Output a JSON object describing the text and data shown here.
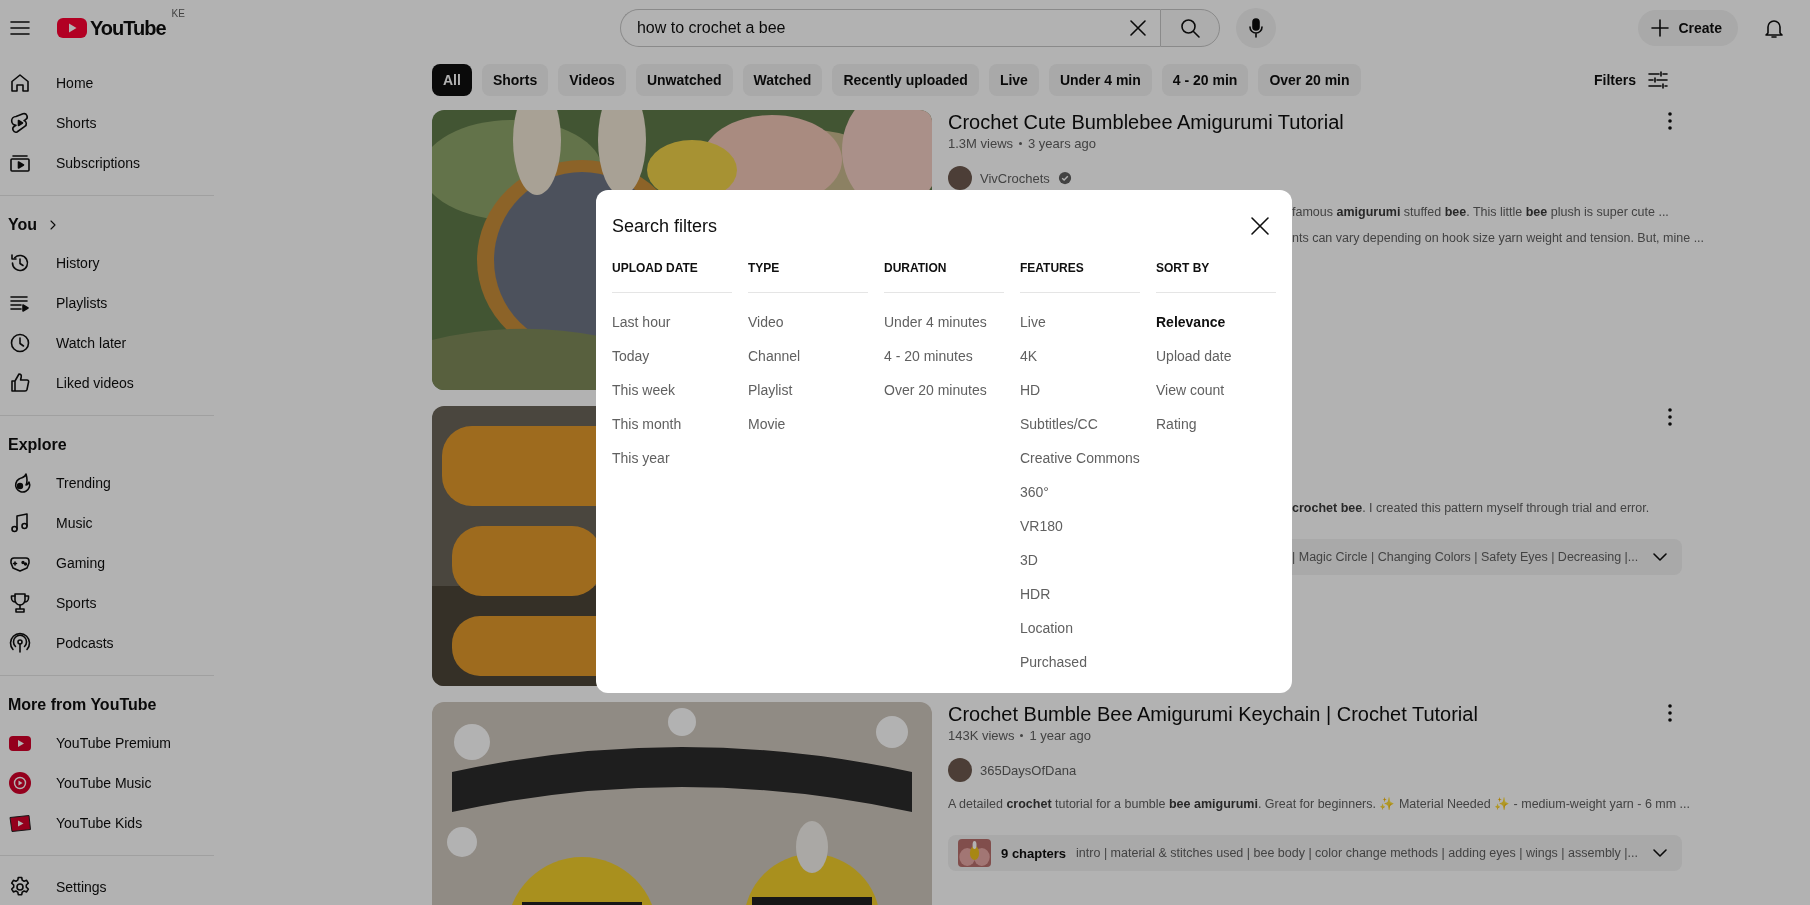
{
  "header": {
    "logo_text": "YouTube",
    "country": "KE",
    "search": {
      "value": "how to crochet a bee"
    },
    "create_label": "Create"
  },
  "sidebar": {
    "sections": [
      {
        "items": [
          {
            "label": "Home"
          },
          {
            "label": "Shorts"
          },
          {
            "label": "Subscriptions"
          }
        ]
      },
      {
        "heading": "You",
        "items": [
          {
            "label": "History"
          },
          {
            "label": "Playlists"
          },
          {
            "label": "Watch later"
          },
          {
            "label": "Liked videos"
          }
        ]
      },
      {
        "heading": "Explore",
        "items": [
          {
            "label": "Trending"
          },
          {
            "label": "Music"
          },
          {
            "label": "Gaming"
          },
          {
            "label": "Sports"
          },
          {
            "label": "Podcasts"
          }
        ]
      },
      {
        "heading": "More from YouTube",
        "items": [
          {
            "label": "YouTube Premium"
          },
          {
            "label": "YouTube Music"
          },
          {
            "label": "YouTube Kids"
          }
        ]
      },
      {
        "items": [
          {
            "label": "Settings"
          }
        ]
      }
    ]
  },
  "chips": [
    {
      "label": "All",
      "selected": true
    },
    {
      "label": "Shorts",
      "selected": false
    },
    {
      "label": "Videos",
      "selected": false
    },
    {
      "label": "Unwatched",
      "selected": false
    },
    {
      "label": "Watched",
      "selected": false
    },
    {
      "label": "Recently uploaded",
      "selected": false
    },
    {
      "label": "Live",
      "selected": false
    },
    {
      "label": "Under 4 min",
      "selected": false
    },
    {
      "label": "4 - 20 min",
      "selected": false
    },
    {
      "label": "Over 20 min",
      "selected": false
    }
  ],
  "filters_label": "Filters",
  "results": [
    {
      "title": "Crochet Cute Bumblebee Amigurumi Tutorial",
      "views": "1.3M views",
      "age": "3 years ago",
      "channel": "VivCrochets",
      "verified": true,
      "description": [
        {
          "kind": "fragment",
          "text": "famous **amigurumi** stuffed **bee**. This little **bee** plush is super cute ..."
        },
        {
          "kind": "fragment",
          "text": "nts can vary depending on hook size yarn weight and tension. But, mine ..."
        }
      ]
    },
    {
      "description": [
        {
          "kind": "fragment",
          "text": "**crochet bee**. I created this pattern myself through trial and error."
        }
      ],
      "chapters": {
        "kind": "fragment",
        "text": "| Magic Circle | Changing Colors | Safety Eyes | Decreasing |..."
      }
    },
    {
      "title": "Crochet Bumble Bee Amigurumi Keychain | Crochet Tutorial",
      "views": "143K views",
      "age": "1 year ago",
      "channel": "365DaysOfDana",
      "verified": false,
      "description": [
        {
          "kind": "full",
          "text": "A detailed **crochet** tutorial for a bumble **bee amigurumi**. Great for beginners. ✨ Material Needed ✨ - medium-weight yarn - 6 mm ..."
        }
      ],
      "chapters": {
        "kind": "full",
        "count": "9 chapters",
        "text": "intro | material & stitches used | bee body | color change methods | adding eyes | wings | assembly |..."
      }
    }
  ],
  "dialog": {
    "title": "Search filters",
    "groups": [
      {
        "heading": "UPLOAD DATE",
        "options": [
          {
            "label": "Last hour",
            "selected": false
          },
          {
            "label": "Today",
            "selected": false
          },
          {
            "label": "This week",
            "selected": false
          },
          {
            "label": "This month",
            "selected": false
          },
          {
            "label": "This year",
            "selected": false
          }
        ]
      },
      {
        "heading": "TYPE",
        "options": [
          {
            "label": "Video",
            "selected": false
          },
          {
            "label": "Channel",
            "selected": false
          },
          {
            "label": "Playlist",
            "selected": false
          },
          {
            "label": "Movie",
            "selected": false
          }
        ]
      },
      {
        "heading": "DURATION",
        "options": [
          {
            "label": "Under 4 minutes",
            "selected": false
          },
          {
            "label": "4 - 20 minutes",
            "selected": false
          },
          {
            "label": "Over 20 minutes",
            "selected": false
          }
        ]
      },
      {
        "heading": "FEATURES",
        "options": [
          {
            "label": "Live",
            "selected": false
          },
          {
            "label": "4K",
            "selected": false
          },
          {
            "label": "HD",
            "selected": false
          },
          {
            "label": "Subtitles/CC",
            "selected": false
          },
          {
            "label": "Creative Commons",
            "selected": false
          },
          {
            "label": "360°",
            "selected": false
          },
          {
            "label": "VR180",
            "selected": false
          },
          {
            "label": "3D",
            "selected": false
          },
          {
            "label": "HDR",
            "selected": false
          },
          {
            "label": "Location",
            "selected": false
          },
          {
            "label": "Purchased",
            "selected": false
          }
        ]
      },
      {
        "heading": "SORT BY",
        "options": [
          {
            "label": "Relevance",
            "selected": true
          },
          {
            "label": "Upload date",
            "selected": false
          },
          {
            "label": "View count",
            "selected": false
          },
          {
            "label": "Rating",
            "selected": false
          }
        ]
      }
    ]
  }
}
